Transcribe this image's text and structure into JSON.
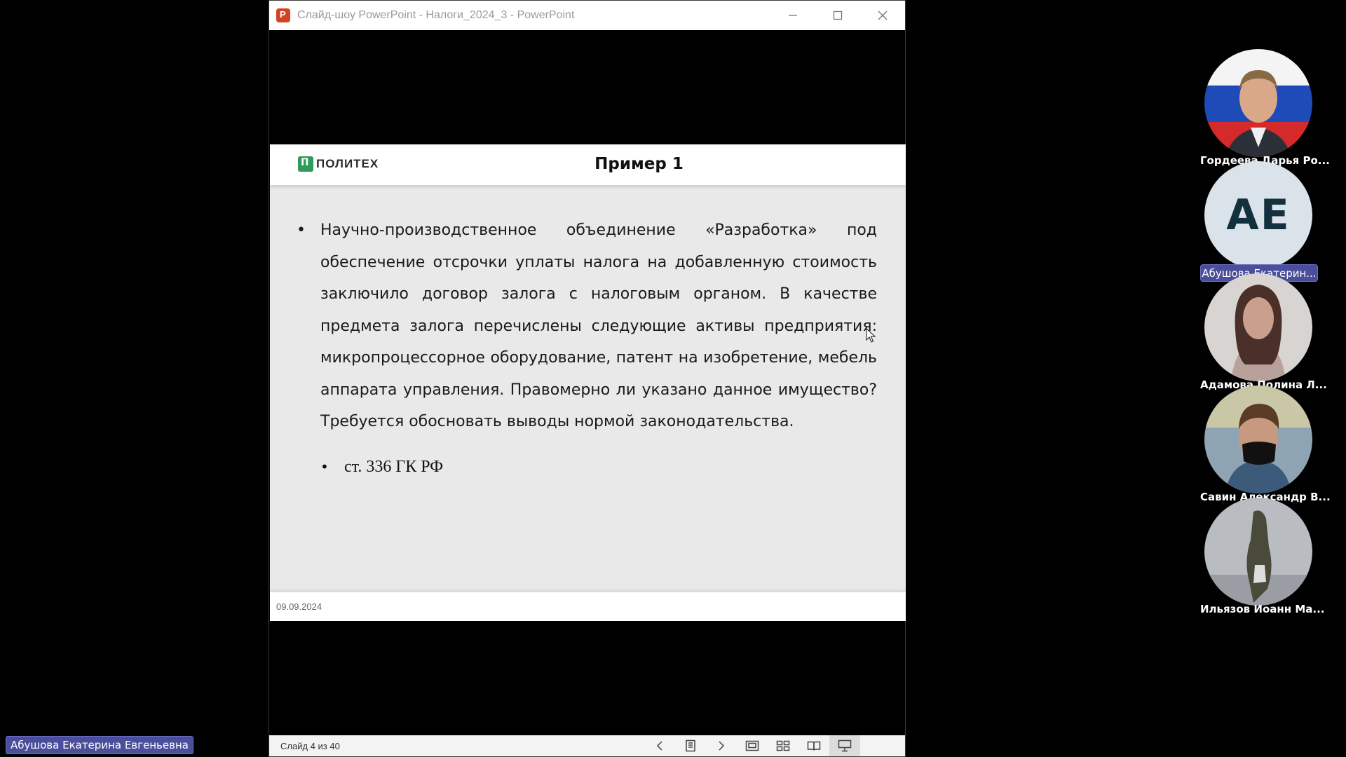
{
  "window": {
    "title": "Слайд-шоу PowerPoint  -  Налоги_2024_3  -  PowerPoint",
    "minimize": "minimize-icon",
    "maximize": "maximize-icon",
    "close": "close-icon"
  },
  "slide": {
    "logo_text": "ПОЛИТЕХ",
    "title": "Пример 1",
    "body": "Научно-производственное объединение «Разработка» под обеспечение отсрочки уплаты налога на добавленную стоимость заключило договор залога с налоговым органом. В качестве предмета залога перечислены следующие активы предприятия: микропроцессорное оборудование, патент на изобретение, мебель аппарата управления. Правомерно ли указано данное имущество? Требуется обосновать выводы нормой законодательства.",
    "reference": "ст. 336 ГК РФ",
    "date": "09.09.2024",
    "bullet": "•"
  },
  "statusbar": {
    "counter": "Слайд 4 из 40",
    "icons": [
      "prev-icon",
      "slide-menu-icon",
      "next-icon",
      "normal-view-icon",
      "slide-sorter-icon",
      "reading-view-icon",
      "slideshow-icon"
    ]
  },
  "participants": [
    {
      "name": "Гордеева Дарья Ро...",
      "active": false
    },
    {
      "name": "Абушова Екатерин...",
      "initials": "АЕ",
      "active": true
    },
    {
      "name": "Адамова Полина Л...",
      "active": false
    },
    {
      "name": "Савин Александр В...",
      "active": false
    },
    {
      "name": "Ильязов Иоанн Ма...",
      "active": false
    }
  ],
  "speaker": "Абушова Екатерина Евгеньевна",
  "colors": {
    "accent": "#4b4e9a",
    "logo": "#2f9a5b",
    "slide_bg": "#e9e9e9"
  }
}
